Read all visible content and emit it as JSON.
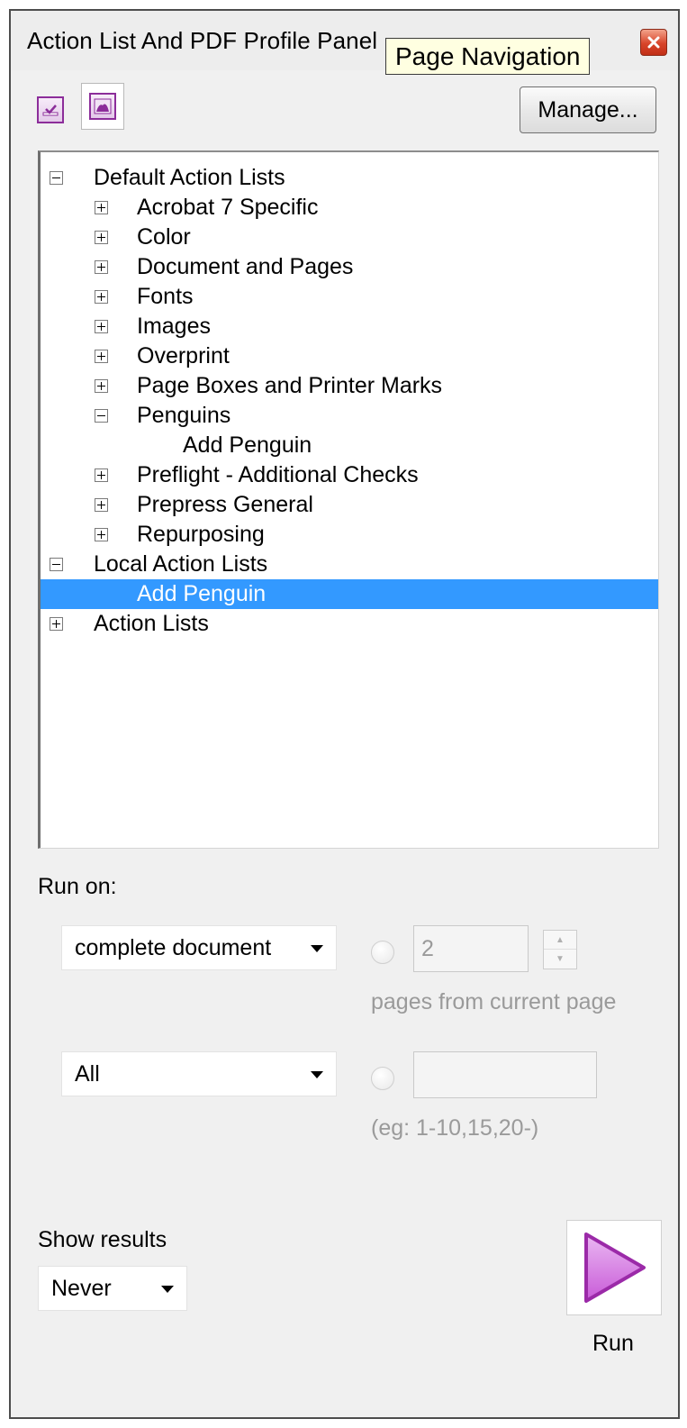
{
  "window": {
    "title": "Action List And PDF Profile Panel",
    "tooltip": "Page Navigation"
  },
  "toolbar": {
    "buttons": [
      {
        "icon": "checkmark-list-icon",
        "pressed": false
      },
      {
        "icon": "profile-image-icon",
        "pressed": true
      }
    ],
    "manage_label": "Manage..."
  },
  "tree": {
    "items": [
      {
        "label": "Default Action Lists",
        "level": 0,
        "toggle": "minus"
      },
      {
        "label": "Acrobat 7 Specific",
        "level": 1,
        "toggle": "plus"
      },
      {
        "label": "Color",
        "level": 1,
        "toggle": "plus"
      },
      {
        "label": "Document and Pages",
        "level": 1,
        "toggle": "plus"
      },
      {
        "label": "Fonts",
        "level": 1,
        "toggle": "plus"
      },
      {
        "label": "Images",
        "level": 1,
        "toggle": "plus"
      },
      {
        "label": "Overprint",
        "level": 1,
        "toggle": "plus"
      },
      {
        "label": "Page Boxes and Printer Marks",
        "level": 1,
        "toggle": "plus"
      },
      {
        "label": "Penguins",
        "level": 1,
        "toggle": "minus"
      },
      {
        "label": "Add Penguin",
        "level": 2,
        "toggle": "none"
      },
      {
        "label": "Preflight - Additional Checks",
        "level": 1,
        "toggle": "plus"
      },
      {
        "label": "Prepress General",
        "level": 1,
        "toggle": "plus"
      },
      {
        "label": "Repurposing",
        "level": 1,
        "toggle": "plus"
      },
      {
        "label": "Local Action Lists",
        "level": 0,
        "toggle": "minus"
      },
      {
        "label": "Add Penguin",
        "level": 1,
        "toggle": "none",
        "selected": true
      },
      {
        "label": "Action Lists",
        "level": 0,
        "toggle": "plus"
      }
    ],
    "selected_color": "#3399ff"
  },
  "run_on": {
    "label": "Run on:",
    "scope_select": "complete document",
    "pages_value": "2",
    "pages_hint": "pages from current page",
    "range_select": "All",
    "range_value": "",
    "range_hint": "(eg: 1-10,15,20-)"
  },
  "results": {
    "label": "Show results",
    "select": "Never"
  },
  "run": {
    "label": "Run",
    "icon": "play-triangle-icon",
    "icon_color": "#c85ad8"
  }
}
